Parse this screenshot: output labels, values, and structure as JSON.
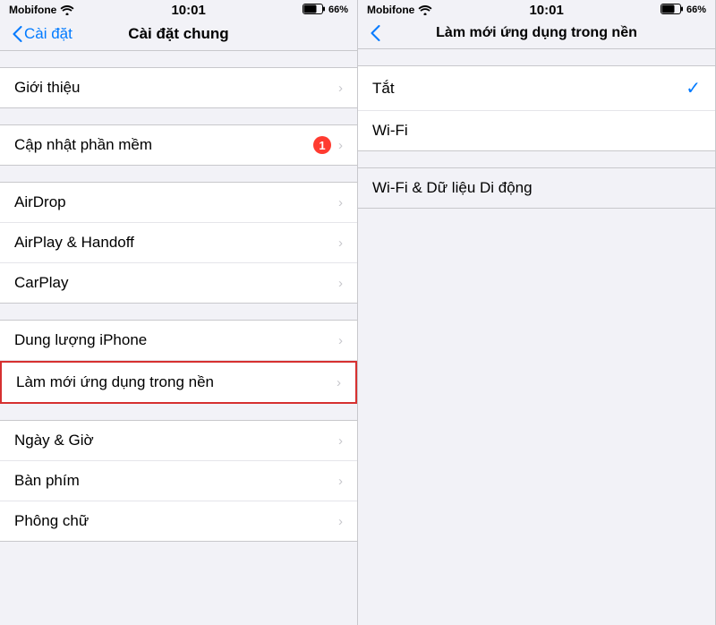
{
  "panel_left": {
    "status": {
      "carrier": "Mobifone",
      "time": "10:01",
      "battery": "66%"
    },
    "nav": {
      "back_label": "Cài đặt",
      "title": "Cài đặt chung"
    },
    "groups": [
      {
        "items": [
          {
            "label": "Giới thiệu",
            "badge": null,
            "chevron": true
          }
        ]
      },
      {
        "items": [
          {
            "label": "Cập nhật phần mềm",
            "badge": "1",
            "chevron": true
          }
        ]
      },
      {
        "items": [
          {
            "label": "AirDrop",
            "badge": null,
            "chevron": true
          },
          {
            "label": "AirPlay & Handoff",
            "badge": null,
            "chevron": true
          },
          {
            "label": "CarPlay",
            "badge": null,
            "chevron": true
          }
        ]
      },
      {
        "items": [
          {
            "label": "Dung lượng iPhone",
            "badge": null,
            "chevron": true
          },
          {
            "label": "Làm mới ứng dụng trong nền",
            "badge": null,
            "chevron": true,
            "highlighted": true
          }
        ]
      },
      {
        "items": [
          {
            "label": "Ngày & Giờ",
            "badge": null,
            "chevron": true
          },
          {
            "label": "Bàn phím",
            "badge": null,
            "chevron": true
          },
          {
            "label": "Phông chữ",
            "badge": null,
            "chevron": true
          }
        ]
      }
    ]
  },
  "panel_right": {
    "status": {
      "carrier": "Mobifone",
      "time": "10:01",
      "battery": "66%"
    },
    "nav": {
      "back_label": "",
      "title": "Làm mới ứng dụng trong nền"
    },
    "options": [
      {
        "label": "Tắt",
        "selected": true
      },
      {
        "label": "Wi-Fi",
        "selected": false
      }
    ],
    "gray_option": {
      "label": "Wi-Fi & Dữ liệu Di động"
    }
  }
}
